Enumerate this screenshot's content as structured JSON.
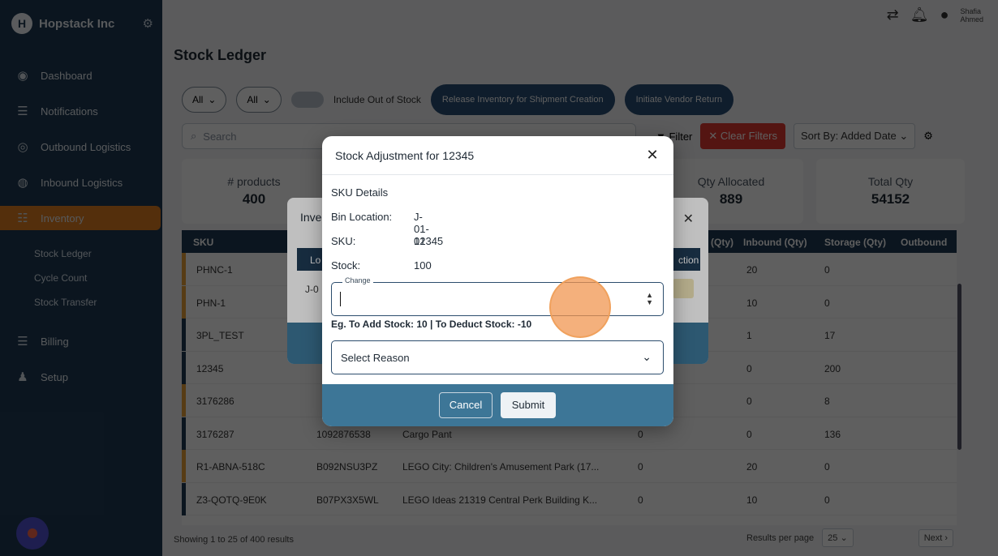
{
  "brand": {
    "name": "Hopstack Inc"
  },
  "sidebar": {
    "items": [
      {
        "label": "Dashboard",
        "icon": "dashboard-icon"
      },
      {
        "label": "Notifications",
        "icon": "list-icon"
      },
      {
        "label": "Outbound Logistics",
        "icon": "outbound-icon"
      },
      {
        "label": "Inbound Logistics",
        "icon": "inbound-icon"
      },
      {
        "label": "Inventory",
        "icon": "inventory-icon"
      }
    ],
    "subitems": [
      "Stock Ledger",
      "Cycle Count",
      "Stock Transfer"
    ],
    "items2": [
      {
        "label": "Billing",
        "icon": "billing-icon"
      },
      {
        "label": "Setup",
        "icon": "setup-icon"
      }
    ]
  },
  "header": {
    "user_line1": "Shafia",
    "user_line2": "Ahmed"
  },
  "page": {
    "title": "Stock Ledger"
  },
  "filters": {
    "all1": "All",
    "all2": "All",
    "include_out": "Include Out of Stock",
    "reserve_btn": "Release Inventory for Shipment Creation",
    "vendor_btn": "Initiate Vendor Return"
  },
  "search": {
    "placeholder": "Search"
  },
  "tools": {
    "filter": "Filter",
    "clear": "Clear Filters",
    "sort": "Sort By: Added Date"
  },
  "stats": [
    {
      "label": "# products",
      "value": "400"
    },
    {
      "label": "Qty Allocated",
      "value": "889"
    },
    {
      "label": "Total Qty",
      "value": "54152"
    }
  ],
  "table": {
    "headers": [
      "SKU",
      "(Qty)",
      "Inbound (Qty)",
      "Storage (Qty)",
      "Outbound"
    ],
    "rows": [
      {
        "sku": "PHNC-1",
        "asin": "",
        "name": "",
        "q1": "",
        "inbound": "20",
        "storage": "0"
      },
      {
        "sku": "PHN-1",
        "asin": "",
        "name": "",
        "q1": "",
        "inbound": "10",
        "storage": "0"
      },
      {
        "sku": "3PL_TEST",
        "asin": "",
        "name": "",
        "q1": "",
        "inbound": "1",
        "storage": "17"
      },
      {
        "sku": "12345",
        "asin": "",
        "name": "",
        "q1": "",
        "inbound": "0",
        "storage": "200"
      },
      {
        "sku": "3176286",
        "asin": "",
        "name": "",
        "q1": "",
        "inbound": "0",
        "storage": "8"
      },
      {
        "sku": "3176287",
        "asin": "1092876538",
        "name": "Cargo Pant",
        "q1": "0",
        "inbound": "0",
        "storage": "136"
      },
      {
        "sku": "R1-ABNA-518C",
        "asin": "B092NSU3PZ",
        "name": "LEGO City: Children's Amusement Park (17...",
        "q1": "0",
        "inbound": "20",
        "storage": "0"
      },
      {
        "sku": "Z3-QOTQ-9E0K",
        "asin": "B07PX3X5WL",
        "name": "LEGO Ideas 21319 Central Perk Building K...",
        "q1": "0",
        "inbound": "10",
        "storage": "0"
      }
    ]
  },
  "footer": {
    "showing": "Showing 1 to 25 of 400 results",
    "rpp_label": "Results per page",
    "rpp_value": "25",
    "next": "Next"
  },
  "inventory_modal": {
    "title": "Inve",
    "col_loc": "Lo",
    "col_action": "ction",
    "row_loc": "J-0"
  },
  "adjust_modal": {
    "title": "Stock Adjustment for 12345",
    "section": "SKU Details",
    "bin_label": "Bin Location:",
    "bin_value": "J-01-01",
    "sku_label": "SKU:",
    "sku_value": "12345",
    "stock_label": "Stock:",
    "stock_value": "100",
    "change_label": "Change",
    "change_value": "",
    "hint": "Eg. To Add Stock: 10 | To Deduct Stock: -10",
    "reason_placeholder": "Select Reason",
    "cancel": "Cancel",
    "submit": "Submit"
  }
}
